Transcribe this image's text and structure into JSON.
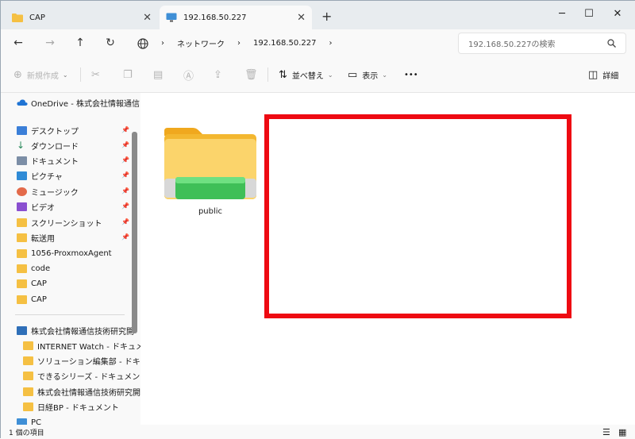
{
  "tabs": [
    {
      "label": "CAP",
      "close": "✕"
    },
    {
      "label": "192.168.50.227",
      "close": "✕"
    }
  ],
  "new_tab": "+",
  "window_controls": {
    "minimize": "─",
    "maximize": "☐",
    "close": "✕"
  },
  "breadcrumb": {
    "items": [
      "ネットワーク",
      "192.168.50.227"
    ],
    "sep": "›"
  },
  "search": {
    "placeholder": "192.168.50.227の検索"
  },
  "commands": {
    "new": "新規作成",
    "sort": "並べ替え",
    "view": "表示",
    "more": "•••",
    "details": "詳細"
  },
  "sidebar": {
    "onedrive": "OneDrive - 株式会社情報通信",
    "quick": [
      {
        "label": "デスクトップ",
        "color": "#3b7fd8"
      },
      {
        "label": "ダウンロード",
        "color": "#2a8a5c"
      },
      {
        "label": "ドキュメント",
        "color": "#7c8ea6"
      },
      {
        "label": "ピクチャ",
        "color": "#2f8bd6"
      },
      {
        "label": "ミュージック",
        "color": "#e36a4a"
      },
      {
        "label": "ビデオ",
        "color": "#8a4fd0"
      },
      {
        "label": "スクリーンショット",
        "color": "#f5c043"
      },
      {
        "label": "転送用",
        "color": "#f5c043"
      },
      {
        "label": "1056-ProxmoxAgent",
        "color": "#f5c043"
      },
      {
        "label": "code",
        "color": "#f5c043"
      },
      {
        "label": "CAP",
        "color": "#f5c043"
      },
      {
        "label": "CAP",
        "color": "#f5c043"
      }
    ],
    "company": "株式会社情報通信技術研究開",
    "company_items": [
      "INTERNET Watch - ドキュメント",
      "ソリューション編集部 - ドキュメン",
      "できるシリーズ - ドキュメント",
      "株式会社情報通信技術研究開",
      "日経BP - ドキュメント"
    ],
    "pc": "PC"
  },
  "content": {
    "folder_name": "public"
  },
  "status": {
    "count": "1 個の項目"
  }
}
